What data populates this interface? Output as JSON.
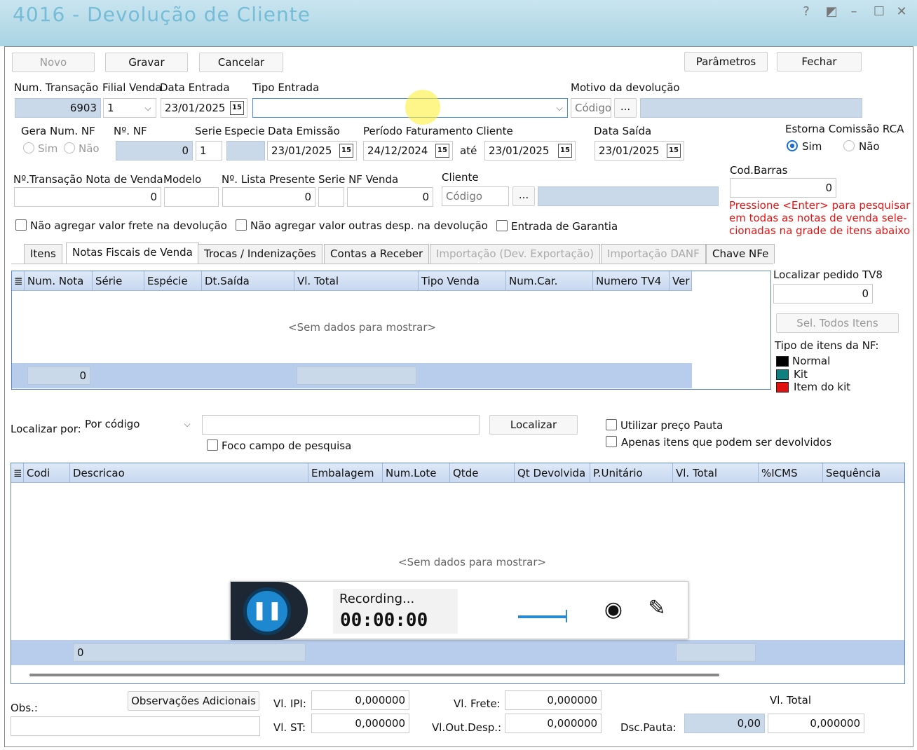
{
  "window": {
    "title": "4016 - Devolução de Cliente",
    "subtitle": "",
    "right_info": ""
  },
  "toolbar": {
    "novo": "Novo",
    "gravar": "Gravar",
    "cancelar": "Cancelar",
    "parametros": "Parâmetros",
    "fechar": "Fechar"
  },
  "row1": {
    "num_transacao_label": "Num. Transação",
    "num_transacao": "6903",
    "filial_label": "Filial Venda",
    "filial": "1",
    "data_entrada_label": "Data Entrada",
    "data_entrada": "23/01/2025",
    "tipo_entrada_label": "Tipo Entrada",
    "tipo_entrada": "",
    "motivo_label": "Motivo da devolução",
    "motivo_placeholder": "Código",
    "ellipsis": "..."
  },
  "row2": {
    "gera_num_label": "Gera Num. NF",
    "sim": "Sim",
    "nao": "Não",
    "num_nf_label": "Nº. NF",
    "num_nf": "0",
    "serie_label": "Serie",
    "serie": "1",
    "especie_label": "Especie",
    "data_emissao_label": "Data Emissão",
    "data_emissao": "23/01/2025",
    "periodo_label": "Período Faturamento Cliente",
    "periodo_de": "24/12/2024",
    "ate": "até",
    "periodo_ate": "23/01/2025",
    "data_saida_label": "Data Saída",
    "data_saida": "23/01/2025",
    "estorna_label": "Estorna Comissão RCA",
    "estorna_sim": "Sim",
    "estorna_nao": "Não"
  },
  "row3": {
    "transacao_nv_label": "Nº.Transação Nota de Venda",
    "transacao_nv": "0",
    "modelo_label": "Modelo",
    "lista_label": "Nº. Lista Presente",
    "lista": "0",
    "serie_nf_label": "Serie NF Venda",
    "nf_venda": "0",
    "cliente_label": "Cliente",
    "cliente_placeholder": "Código",
    "ellipsis": "...",
    "cod_barras_label": "Cod.Barras",
    "cod_barras": "0",
    "hint": [
      "Pressione <Enter> para pesquisar",
      "em todas as notas de venda sele-",
      "cionadas na grade de itens abaixo"
    ]
  },
  "checks": {
    "frete": "Não agregar valor frete  na devolução",
    "outras": "Não agregar valor outras desp. na devolução",
    "garantia": "Entrada de Garantia"
  },
  "tabs": [
    "Itens",
    "Notas Fiscais de Venda",
    "Trocas / Indenizações",
    "Contas a Receber",
    "Importação (Dev. Exportação)",
    "Importação DANF",
    "Chave NFe"
  ],
  "grid1": {
    "columns": [
      "Num. Nota",
      "Série",
      "Espécie",
      "Dt.Saída",
      "Vl. Total",
      "Tipo Venda",
      "Num.Car.",
      "Numero TV4",
      "Ver"
    ],
    "empty": "<Sem dados para mostrar>",
    "footer_count": "0"
  },
  "side": {
    "localizar_tv8_label": "Localizar pedido TV8",
    "localizar_tv8": "0",
    "sel_todos": "Sel. Todos Itens",
    "tipo_label": "Tipo de itens da NF:",
    "legend": [
      {
        "label": "Normal",
        "color": "#000000"
      },
      {
        "label": "Kit",
        "color": "#0f7f7f"
      },
      {
        "label": "Item do kit",
        "color": "#e01010"
      }
    ]
  },
  "search": {
    "localizar_por_label": "Localizar por:",
    "localizar_por": "Por código",
    "localizar_btn": "Localizar",
    "foco": "Foco campo de pesquisa",
    "preco_pauta": "Utilizar preço Pauta",
    "apenas": "Apenas itens que podem ser devolvidos"
  },
  "grid2": {
    "columns": [
      "Codi",
      "Descricao",
      "Embalagem",
      "Num.Lote",
      "Qtde",
      "Qt Devolvida",
      "P.Unitário",
      "Vl. Total",
      "%ICMS",
      "Sequência"
    ],
    "empty": "<Sem dados para mostrar>",
    "footer_count": "0"
  },
  "recorder": {
    "status": "Recording...",
    "time": "00:00:00"
  },
  "bottom": {
    "obs_label": "Obs.:",
    "obs_btn": "Observações Adicionais",
    "ipi_label": "Vl. IPI:",
    "ipi": "0,000000",
    "st_label": "Vl. ST:",
    "st": "0,000000",
    "frete_label": "Vl. Frete:",
    "frete": "0,000000",
    "outdesp_label": "Vl.Out.Desp.:",
    "outdesp": "0,000000",
    "dsc_label": "Dsc.Pauta:",
    "dsc": "0,00",
    "total_label": "Vl. Total",
    "total": "0,000000"
  }
}
